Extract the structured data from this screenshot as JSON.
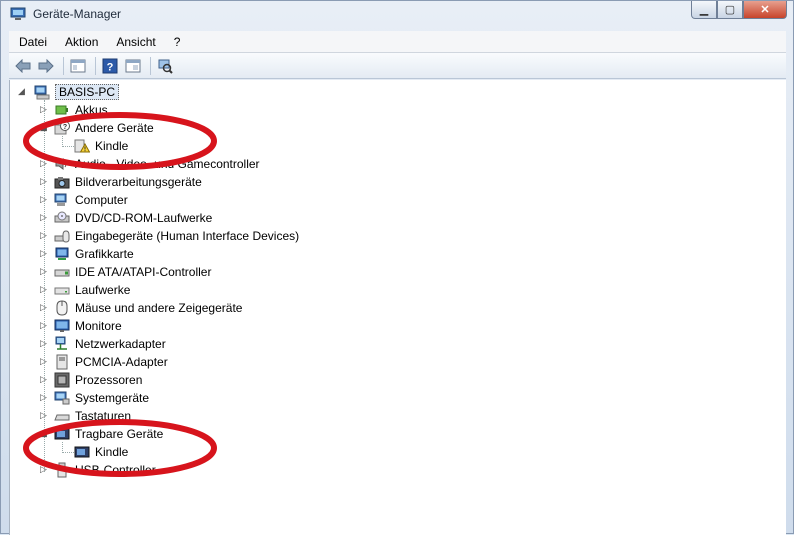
{
  "window": {
    "title": "Geräte-Manager",
    "controls": {
      "minimize": "▁",
      "maximize": "▢",
      "close": "✕"
    }
  },
  "menu": [
    "Datei",
    "Aktion",
    "Ansicht",
    "?"
  ],
  "toolbar": {
    "buttons": [
      "back-icon",
      "forward-icon",
      "properties-icon",
      "help-icon",
      "show-hide-icon",
      "scan-hardware-icon"
    ]
  },
  "tree": {
    "root": "BASIS-PC",
    "categories": [
      {
        "label": "Akkus"
      },
      {
        "label": "Andere Geräte",
        "expanded": true,
        "children": [
          "Kindle"
        ]
      },
      {
        "label": "Audio-, Video- und Gamecontroller"
      },
      {
        "label": "Bildverarbeitungsgeräte"
      },
      {
        "label": "Computer"
      },
      {
        "label": "DVD/CD-ROM-Laufwerke"
      },
      {
        "label": "Eingabegeräte (Human Interface Devices)"
      },
      {
        "label": "Grafikkarte"
      },
      {
        "label": "IDE ATA/ATAPI-Controller"
      },
      {
        "label": "Laufwerke"
      },
      {
        "label": "Mäuse und andere Zeigegeräte"
      },
      {
        "label": "Monitore"
      },
      {
        "label": "Netzwerkadapter"
      },
      {
        "label": "PCMCIA-Adapter"
      },
      {
        "label": "Prozessoren"
      },
      {
        "label": "Systemgeräte"
      },
      {
        "label": "Tastaturen"
      },
      {
        "label": "Tragbare Geräte",
        "expanded": true,
        "children": [
          "Kindle"
        ]
      },
      {
        "label": "USB-Controller"
      }
    ]
  },
  "annotation_color": "#d7141c",
  "highlight_color": "#dde8f5"
}
